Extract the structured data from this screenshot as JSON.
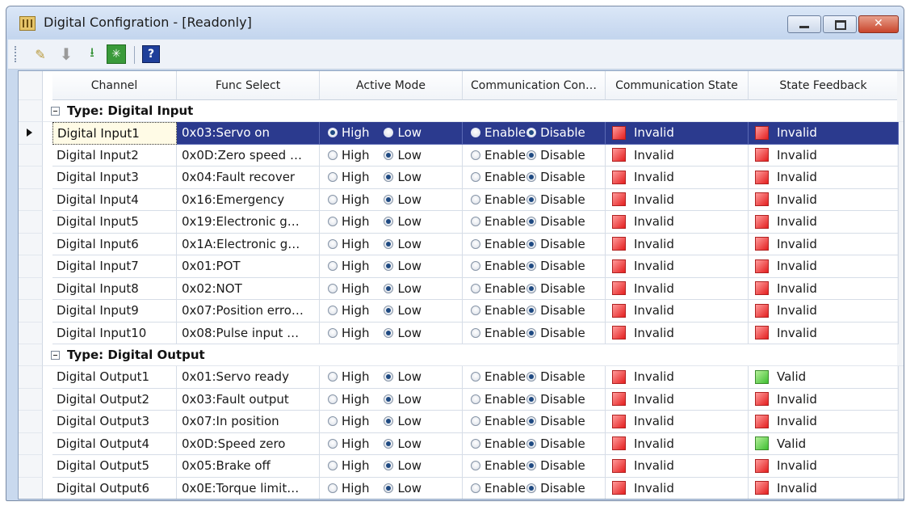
{
  "window": {
    "title": "Digital Configration - [Readonly]"
  },
  "toolbar": {
    "buttons": [
      {
        "name": "edit",
        "icon": "pencil-edit-icon"
      },
      {
        "name": "download",
        "icon": "down-arrow-icon"
      },
      {
        "name": "export",
        "icon": "export-tray-icon"
      },
      {
        "name": "grid",
        "icon": "grid-config-icon"
      },
      {
        "name": "help",
        "icon": "help-icon",
        "label": "?"
      }
    ]
  },
  "columns": [
    "Channel",
    "Func Select",
    "Active Mode",
    "Communication Con…",
    "Communication State",
    "State Feedback"
  ],
  "colors": {
    "selection": "#2b3a8e",
    "invalid": "#e41f1f",
    "valid": "#3fbf32"
  },
  "labels": {
    "high": "High",
    "low": "Low",
    "enable": "Enable",
    "disable": "Disable"
  },
  "groups": [
    {
      "label": "Type: Digital Input",
      "rows": [
        {
          "channel": "Digital Input1",
          "func": "0x03:Servo on",
          "active_mode": "high",
          "comm": "disable",
          "state": "Invalid",
          "feedback": "Invalid",
          "selected": true
        },
        {
          "channel": "Digital Input2",
          "func": "0x0D:Zero speed …",
          "active_mode": "low",
          "comm": "disable",
          "state": "Invalid",
          "feedback": "Invalid"
        },
        {
          "channel": "Digital Input3",
          "func": "0x04:Fault recover",
          "active_mode": "low",
          "comm": "disable",
          "state": "Invalid",
          "feedback": "Invalid"
        },
        {
          "channel": "Digital Input4",
          "func": "0x16:Emergency",
          "active_mode": "low",
          "comm": "disable",
          "state": "Invalid",
          "feedback": "Invalid"
        },
        {
          "channel": "Digital Input5",
          "func": "0x19:Electronic g…",
          "active_mode": "low",
          "comm": "disable",
          "state": "Invalid",
          "feedback": "Invalid"
        },
        {
          "channel": "Digital Input6",
          "func": "0x1A:Electronic g…",
          "active_mode": "low",
          "comm": "disable",
          "state": "Invalid",
          "feedback": "Invalid"
        },
        {
          "channel": "Digital Input7",
          "func": "0x01:POT",
          "active_mode": "low",
          "comm": "disable",
          "state": "Invalid",
          "feedback": "Invalid"
        },
        {
          "channel": "Digital Input8",
          "func": "0x02:NOT",
          "active_mode": "low",
          "comm": "disable",
          "state": "Invalid",
          "feedback": "Invalid"
        },
        {
          "channel": "Digital Input9",
          "func": "0x07:Position erro…",
          "active_mode": "low",
          "comm": "disable",
          "state": "Invalid",
          "feedback": "Invalid"
        },
        {
          "channel": "Digital Input10",
          "func": "0x08:Pulse input …",
          "active_mode": "low",
          "comm": "disable",
          "state": "Invalid",
          "feedback": "Invalid"
        }
      ]
    },
    {
      "label": "Type: Digital Output",
      "rows": [
        {
          "channel": "Digital Output1",
          "func": "0x01:Servo ready",
          "active_mode": "low",
          "comm": "disable",
          "state": "Invalid",
          "feedback": "Valid"
        },
        {
          "channel": "Digital Output2",
          "func": "0x03:Fault output",
          "active_mode": "low",
          "comm": "disable",
          "state": "Invalid",
          "feedback": "Invalid"
        },
        {
          "channel": "Digital Output3",
          "func": "0x07:In position",
          "active_mode": "low",
          "comm": "disable",
          "state": "Invalid",
          "feedback": "Invalid"
        },
        {
          "channel": "Digital Output4",
          "func": "0x0D:Speed zero",
          "active_mode": "low",
          "comm": "disable",
          "state": "Invalid",
          "feedback": "Valid"
        },
        {
          "channel": "Digital Output5",
          "func": "0x05:Brake off",
          "active_mode": "low",
          "comm": "disable",
          "state": "Invalid",
          "feedback": "Invalid"
        },
        {
          "channel": "Digital Output6",
          "func": "0x0E:Torque limit…",
          "active_mode": "low",
          "comm": "disable",
          "state": "Invalid",
          "feedback": "Invalid"
        }
      ]
    }
  ]
}
